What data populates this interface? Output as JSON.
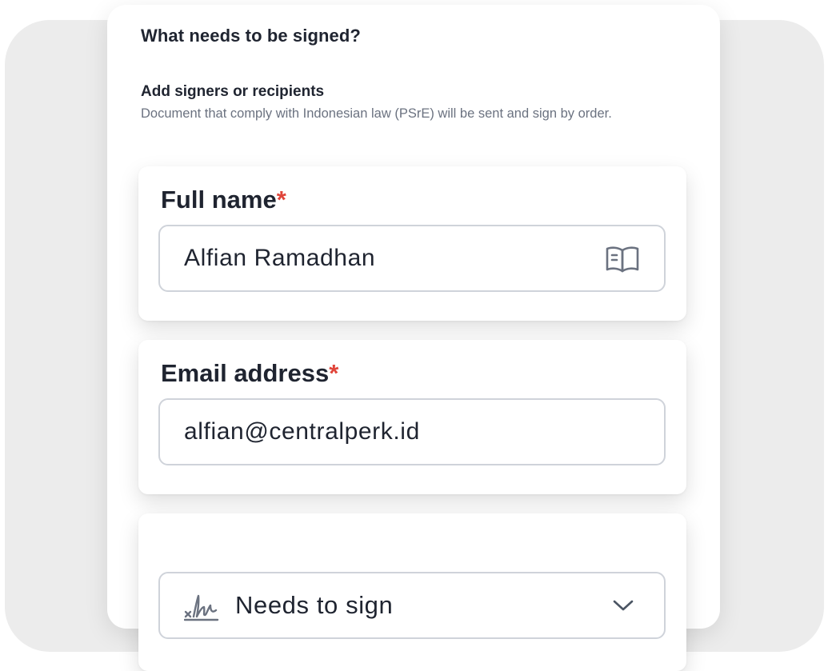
{
  "form": {
    "title": "What needs to be signed?",
    "section_title": "Add signers or recipients",
    "section_subtitle": "Document that comply with Indonesian law (PSrE) will be sent and sign by order."
  },
  "signer": {
    "full_name": {
      "label": "Full name",
      "required_mark": "*",
      "value": "Alfian Ramadhan",
      "icon": "contact-book-icon"
    },
    "email": {
      "label": "Email address",
      "required_mark": "*",
      "value": "alfian@centralperk.id"
    },
    "role": {
      "selected": "Needs to sign",
      "icon": "signature-icon",
      "dropdown_icon": "chevron-down-icon"
    }
  },
  "colors": {
    "text_primary": "#1f2430",
    "text_secondary": "#6b7280",
    "required": "#e0453a",
    "input_border": "#cfd3da",
    "icon": "#6b7280",
    "backdrop": "#ececec"
  }
}
